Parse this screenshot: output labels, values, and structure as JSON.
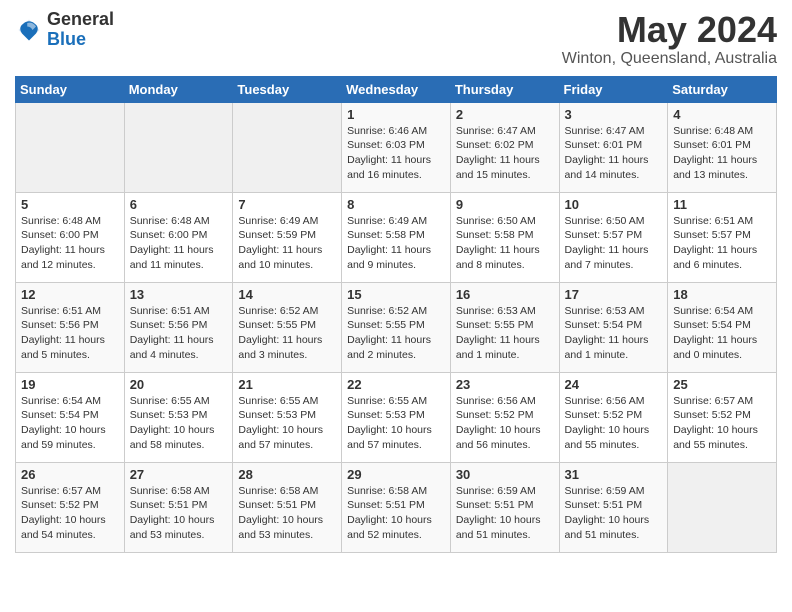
{
  "header": {
    "logo_general": "General",
    "logo_blue": "Blue",
    "title": "May 2024",
    "subtitle": "Winton, Queensland, Australia"
  },
  "calendar": {
    "days_of_week": [
      "Sunday",
      "Monday",
      "Tuesday",
      "Wednesday",
      "Thursday",
      "Friday",
      "Saturday"
    ],
    "weeks": [
      [
        {
          "day": "",
          "detail": ""
        },
        {
          "day": "",
          "detail": ""
        },
        {
          "day": "",
          "detail": ""
        },
        {
          "day": "1",
          "detail": "Sunrise: 6:46 AM\nSunset: 6:03 PM\nDaylight: 11 hours\nand 16 minutes."
        },
        {
          "day": "2",
          "detail": "Sunrise: 6:47 AM\nSunset: 6:02 PM\nDaylight: 11 hours\nand 15 minutes."
        },
        {
          "day": "3",
          "detail": "Sunrise: 6:47 AM\nSunset: 6:01 PM\nDaylight: 11 hours\nand 14 minutes."
        },
        {
          "day": "4",
          "detail": "Sunrise: 6:48 AM\nSunset: 6:01 PM\nDaylight: 11 hours\nand 13 minutes."
        }
      ],
      [
        {
          "day": "5",
          "detail": "Sunrise: 6:48 AM\nSunset: 6:00 PM\nDaylight: 11 hours\nand 12 minutes."
        },
        {
          "day": "6",
          "detail": "Sunrise: 6:48 AM\nSunset: 6:00 PM\nDaylight: 11 hours\nand 11 minutes."
        },
        {
          "day": "7",
          "detail": "Sunrise: 6:49 AM\nSunset: 5:59 PM\nDaylight: 11 hours\nand 10 minutes."
        },
        {
          "day": "8",
          "detail": "Sunrise: 6:49 AM\nSunset: 5:58 PM\nDaylight: 11 hours\nand 9 minutes."
        },
        {
          "day": "9",
          "detail": "Sunrise: 6:50 AM\nSunset: 5:58 PM\nDaylight: 11 hours\nand 8 minutes."
        },
        {
          "day": "10",
          "detail": "Sunrise: 6:50 AM\nSunset: 5:57 PM\nDaylight: 11 hours\nand 7 minutes."
        },
        {
          "day": "11",
          "detail": "Sunrise: 6:51 AM\nSunset: 5:57 PM\nDaylight: 11 hours\nand 6 minutes."
        }
      ],
      [
        {
          "day": "12",
          "detail": "Sunrise: 6:51 AM\nSunset: 5:56 PM\nDaylight: 11 hours\nand 5 minutes."
        },
        {
          "day": "13",
          "detail": "Sunrise: 6:51 AM\nSunset: 5:56 PM\nDaylight: 11 hours\nand 4 minutes."
        },
        {
          "day": "14",
          "detail": "Sunrise: 6:52 AM\nSunset: 5:55 PM\nDaylight: 11 hours\nand 3 minutes."
        },
        {
          "day": "15",
          "detail": "Sunrise: 6:52 AM\nSunset: 5:55 PM\nDaylight: 11 hours\nand 2 minutes."
        },
        {
          "day": "16",
          "detail": "Sunrise: 6:53 AM\nSunset: 5:55 PM\nDaylight: 11 hours\nand 1 minute."
        },
        {
          "day": "17",
          "detail": "Sunrise: 6:53 AM\nSunset: 5:54 PM\nDaylight: 11 hours\nand 1 minute."
        },
        {
          "day": "18",
          "detail": "Sunrise: 6:54 AM\nSunset: 5:54 PM\nDaylight: 11 hours\nand 0 minutes."
        }
      ],
      [
        {
          "day": "19",
          "detail": "Sunrise: 6:54 AM\nSunset: 5:54 PM\nDaylight: 10 hours\nand 59 minutes."
        },
        {
          "day": "20",
          "detail": "Sunrise: 6:55 AM\nSunset: 5:53 PM\nDaylight: 10 hours\nand 58 minutes."
        },
        {
          "day": "21",
          "detail": "Sunrise: 6:55 AM\nSunset: 5:53 PM\nDaylight: 10 hours\nand 57 minutes."
        },
        {
          "day": "22",
          "detail": "Sunrise: 6:55 AM\nSunset: 5:53 PM\nDaylight: 10 hours\nand 57 minutes."
        },
        {
          "day": "23",
          "detail": "Sunrise: 6:56 AM\nSunset: 5:52 PM\nDaylight: 10 hours\nand 56 minutes."
        },
        {
          "day": "24",
          "detail": "Sunrise: 6:56 AM\nSunset: 5:52 PM\nDaylight: 10 hours\nand 55 minutes."
        },
        {
          "day": "25",
          "detail": "Sunrise: 6:57 AM\nSunset: 5:52 PM\nDaylight: 10 hours\nand 55 minutes."
        }
      ],
      [
        {
          "day": "26",
          "detail": "Sunrise: 6:57 AM\nSunset: 5:52 PM\nDaylight: 10 hours\nand 54 minutes."
        },
        {
          "day": "27",
          "detail": "Sunrise: 6:58 AM\nSunset: 5:51 PM\nDaylight: 10 hours\nand 53 minutes."
        },
        {
          "day": "28",
          "detail": "Sunrise: 6:58 AM\nSunset: 5:51 PM\nDaylight: 10 hours\nand 53 minutes."
        },
        {
          "day": "29",
          "detail": "Sunrise: 6:58 AM\nSunset: 5:51 PM\nDaylight: 10 hours\nand 52 minutes."
        },
        {
          "day": "30",
          "detail": "Sunrise: 6:59 AM\nSunset: 5:51 PM\nDaylight: 10 hours\nand 51 minutes."
        },
        {
          "day": "31",
          "detail": "Sunrise: 6:59 AM\nSunset: 5:51 PM\nDaylight: 10 hours\nand 51 minutes."
        },
        {
          "day": "",
          "detail": ""
        }
      ]
    ]
  }
}
